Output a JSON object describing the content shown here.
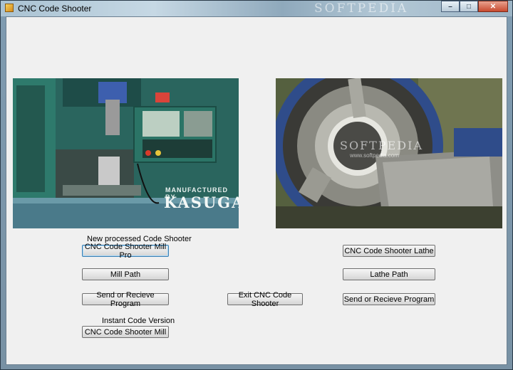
{
  "window": {
    "title": "CNC Code Shooter",
    "watermark": "SOFTPEDIA",
    "controls": {
      "minimize": "–",
      "maximize": "□",
      "close": "✕"
    }
  },
  "images": {
    "mill": {
      "text": "MANUFACTURED BY",
      "brand": "KASUGA"
    },
    "lathe": {
      "watermark": "SOFTPEDIA",
      "watermark_sub": "www.softpedia.com"
    }
  },
  "mill_section": {
    "caption": "New processed Code Shooter",
    "pro_button": "CNC Code Shooter Mill Pro",
    "path_button": "Mill Path",
    "send_button": "Send or Recieve Program",
    "instant_caption": "Instant Code Version",
    "mill_button": "CNC Code Shooter Mill"
  },
  "center": {
    "exit_button": "Exit CNC Code Shooter"
  },
  "lathe_section": {
    "lathe_button": "CNC Code Shooter Lathe",
    "path_button": "Lathe Path",
    "send_button": "Send or Recieve Program"
  },
  "colors": {
    "client_bg": "#f0f0f0",
    "focus_border": "#3c7fb1"
  }
}
